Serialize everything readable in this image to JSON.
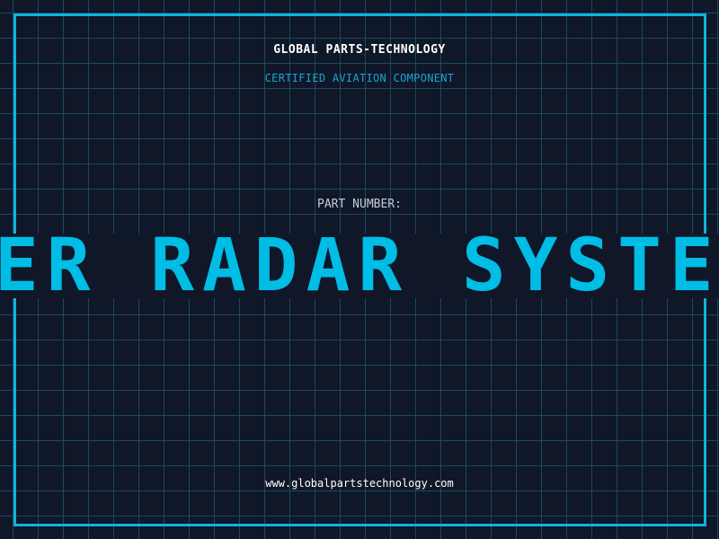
{
  "header": {
    "company": "GLOBAL PARTS-TECHNOLOGY",
    "certification": "CERTIFIED AVIATION COMPONENT"
  },
  "part": {
    "label": "PART NUMBER:",
    "number": "LER RADAR SYSTEM P"
  },
  "footer": {
    "url": "www.globalpartstechnology.com"
  },
  "colors": {
    "background": "#0f1729",
    "grid": "#1b4a5e",
    "accent": "#00bde6",
    "frame": "#0fb4dc",
    "certification_text": "#1ea3d2"
  }
}
